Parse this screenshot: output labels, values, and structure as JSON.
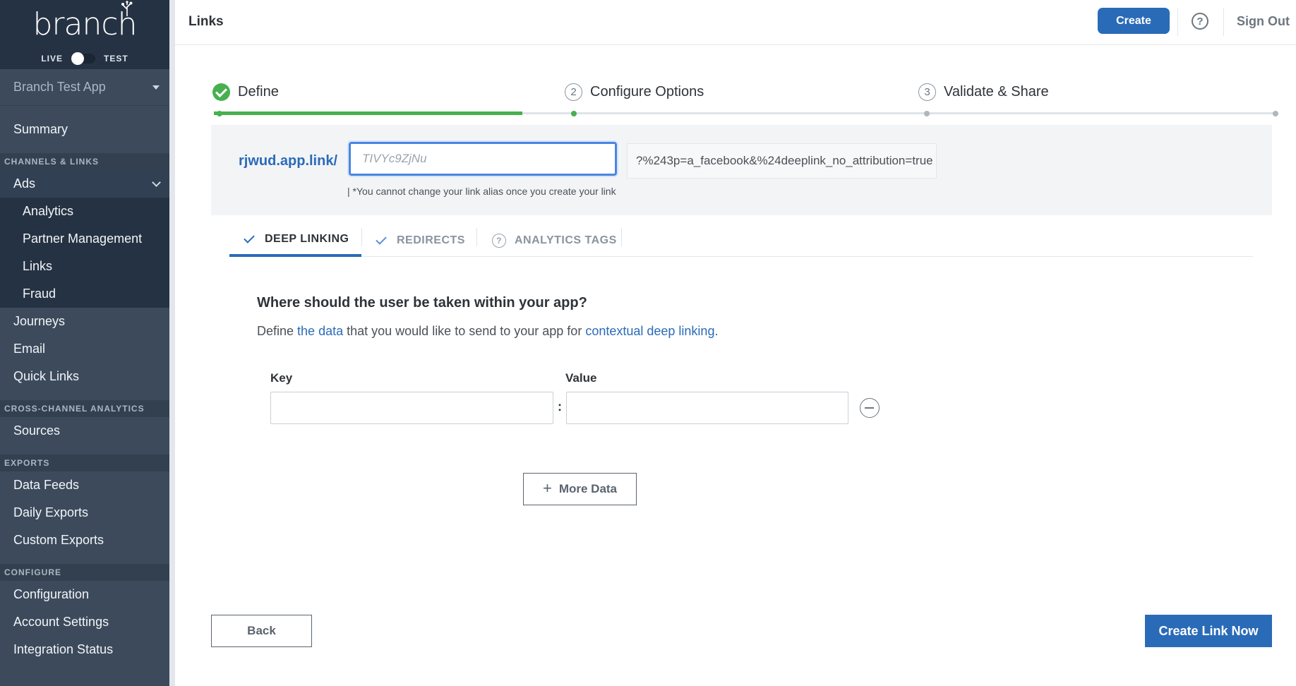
{
  "brand": {
    "logo_text": "branch",
    "env_live": "LIVE",
    "env_test": "TEST"
  },
  "app_selector": {
    "selected": "Branch Test App"
  },
  "sidebar": {
    "summary": "Summary",
    "sections": {
      "channels": "CHANNELS & LINKS",
      "cross_channel": "CROSS-CHANNEL ANALYTICS",
      "exports": "EXPORTS",
      "configure": "CONFIGURE"
    },
    "ads": "Ads",
    "ads_children": [
      "Analytics",
      "Partner Management",
      "Links",
      "Fraud"
    ],
    "channels_items": [
      "Journeys",
      "Email",
      "Quick Links"
    ],
    "cross_channel_items": [
      "Sources"
    ],
    "exports_items": [
      "Data Feeds",
      "Daily Exports",
      "Custom Exports"
    ],
    "configure_items": [
      "Configuration",
      "Account Settings",
      "Integration Status"
    ]
  },
  "header": {
    "title": "Links",
    "create_label": "Create",
    "sign_out_label": "Sign Out"
  },
  "stepper": {
    "steps": [
      {
        "number": "1",
        "label": "Define",
        "status": "complete"
      },
      {
        "number": "2",
        "label": "Configure Options",
        "status": "pending"
      },
      {
        "number": "3",
        "label": "Validate & Share",
        "status": "pending"
      }
    ],
    "progress_fraction": 0.29
  },
  "alias": {
    "domain": "rjwud.app.link/",
    "placeholder": "TIVYc9ZjNu",
    "hint": "| *You cannot change your link alias once you create your link",
    "query_string": "?%243p=a_facebook&%24deeplink_no_attribution=true"
  },
  "tabs": [
    {
      "label": "DEEP LINKING",
      "icon": "check-icon",
      "active": true
    },
    {
      "label": "REDIRECTS",
      "icon": "check-icon",
      "active": false
    },
    {
      "label": "ANALYTICS TAGS",
      "icon": "question-circle-icon",
      "active": false
    }
  ],
  "deep_linking": {
    "question": "Where should the user be taken within your app?",
    "desc_prefix": "Define ",
    "desc_link1": "the data",
    "desc_middle": " that you would like to send to your app for ",
    "desc_link2": "contextual deep linking",
    "desc_suffix": ".",
    "key_label": "Key",
    "value_label": "Value",
    "key_value": "",
    "value_value": "",
    "separator": ":",
    "more_data_label": "More Data"
  },
  "footer": {
    "back_label": "Back",
    "create_link_label": "Create Link Now"
  },
  "colors": {
    "accent": "#2a6bb8",
    "success": "#48b04f",
    "sidebar_bg": "#3c4a5c",
    "sidebar_dark": "#253243"
  }
}
